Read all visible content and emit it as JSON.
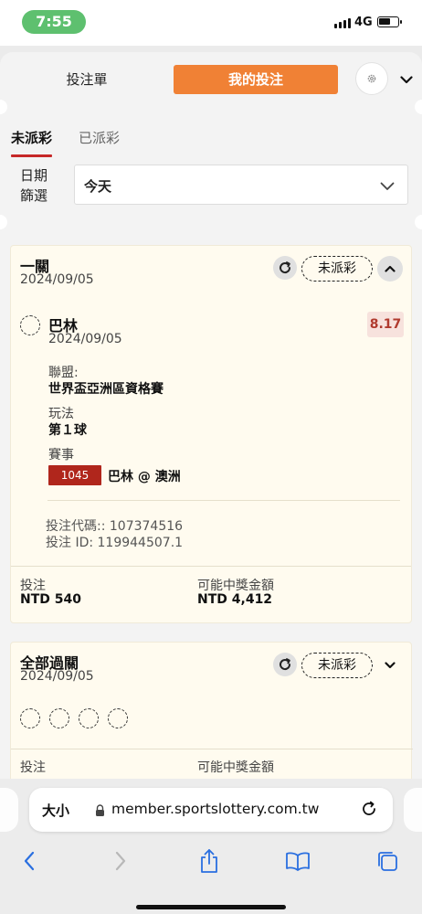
{
  "status_bar": {
    "time": "7:55",
    "network": "4G"
  },
  "header": {
    "tab_bet_slip": "投注單",
    "tab_my_bets": "我的投注",
    "accent_color": "#f08135"
  },
  "subtabs": {
    "unsettled": "未派彩",
    "settled": "已派彩"
  },
  "date_filter": {
    "label_line1": "日期",
    "label_line2": "篩選",
    "selected": "今天"
  },
  "bets": [
    {
      "title": "一關",
      "date": "2024/09/05",
      "status": "未派彩",
      "selection": {
        "team": "巴林",
        "date": "2024/09/05",
        "odds": "8.17",
        "league_label": "聯盟:",
        "league": "世界盃亞洲區資格賽",
        "market_label": "玩法",
        "market": "第１球",
        "event_label": "賽事",
        "match_code": "1045",
        "match": "巴林 @ 澳洲"
      },
      "bet_code": "投注代碼:: 107374516",
      "bet_id": "投注 ID: 119944507.1",
      "stake_label": "投注",
      "stake": "NTD 540",
      "payout_label": "可能中獎金額",
      "payout": "NTD 4,412"
    },
    {
      "title": "全部過關",
      "date": "2024/09/05",
      "status": "未派彩",
      "stake_label": "投注",
      "payout_label": "可能中獎金額"
    }
  ],
  "browser": {
    "font_size_label": "大小",
    "url": "member.sportslottery.com.tw"
  }
}
